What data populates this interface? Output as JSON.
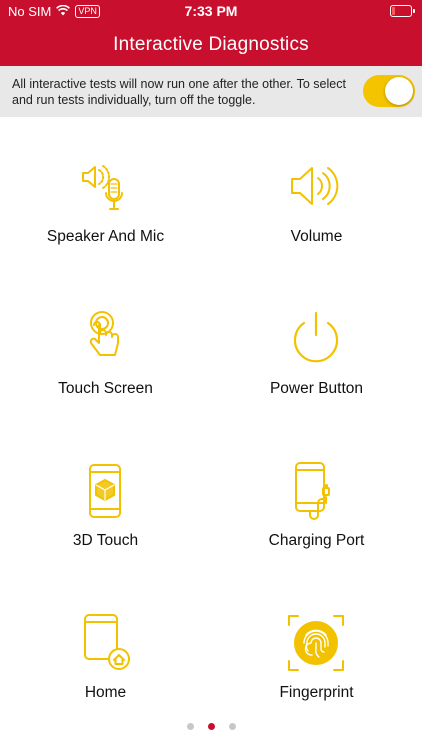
{
  "status_bar": {
    "carrier": "No SIM",
    "vpn": "VPN",
    "time": "7:33 PM",
    "battery_icon": "battery-low-icon",
    "wifi_icon": "wifi-icon"
  },
  "header": {
    "title": "Interactive Diagnostics",
    "background_color": "#c8102e"
  },
  "toggle_banner": {
    "text": "All interactive tests will now run one after the other. To select and run tests individually, turn off the toggle.",
    "toggle_on": true,
    "toggle_color": "#f5c400"
  },
  "tests": [
    {
      "label": "Speaker And Mic",
      "icon": "speaker-mic-icon"
    },
    {
      "label": "Volume",
      "icon": "volume-icon"
    },
    {
      "label": "Touch Screen",
      "icon": "touch-screen-icon"
    },
    {
      "label": "Power Button",
      "icon": "power-icon"
    },
    {
      "label": "3D Touch",
      "icon": "3d-touch-icon"
    },
    {
      "label": "Charging Port",
      "icon": "charging-port-icon"
    },
    {
      "label": "Home",
      "icon": "home-button-icon"
    },
    {
      "label": "Fingerprint",
      "icon": "fingerprint-icon"
    }
  ],
  "icon_color": "#f2c200",
  "pager": {
    "pages": 3,
    "current": 2
  }
}
